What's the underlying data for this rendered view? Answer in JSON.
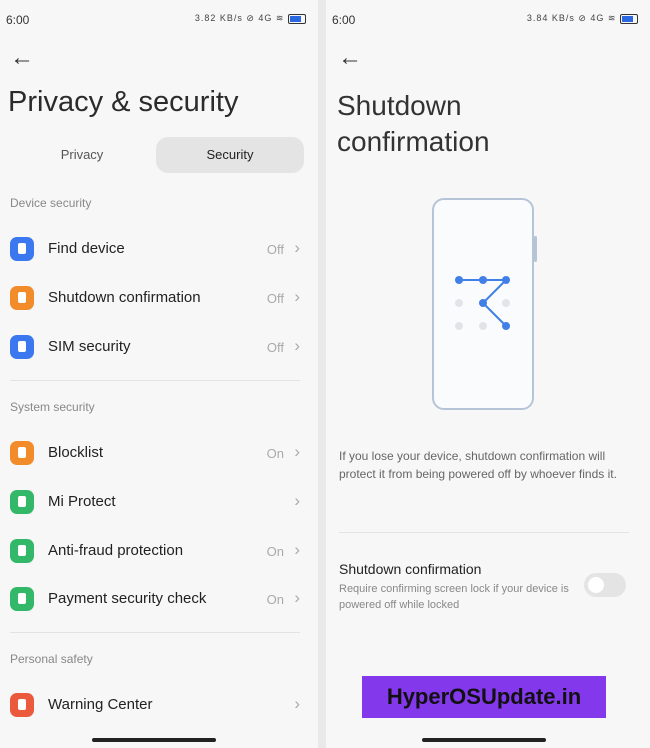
{
  "left": {
    "status": {
      "time": "6:00",
      "icons": "3.82 KB/s ⊘ 4G ≋"
    },
    "title": "Privacy & security",
    "tabs": [
      {
        "label": "Privacy",
        "selected": false
      },
      {
        "label": "Security",
        "selected": true
      }
    ],
    "sections": [
      {
        "label": "Device security",
        "items": [
          {
            "label": "Find device",
            "value": "Off",
            "icon": "find-device-icon",
            "color": "#3b78f0"
          },
          {
            "label": "Shutdown confirmation",
            "value": "Off",
            "icon": "lock-icon",
            "color": "#f28c2a"
          },
          {
            "label": "SIM security",
            "value": "Off",
            "icon": "sim-card-icon",
            "color": "#3b78f0"
          }
        ]
      },
      {
        "label": "System security",
        "items": [
          {
            "label": "Blocklist",
            "value": "On",
            "icon": "shield-icon",
            "color": "#f28c2a"
          },
          {
            "label": "Mi Protect",
            "value": "",
            "icon": "shield-check-icon",
            "color": "#33b86a"
          },
          {
            "label": "Anti-fraud protection",
            "value": "On",
            "icon": "phone-icon",
            "color": "#33b86a"
          },
          {
            "label": "Payment security check",
            "value": "On",
            "icon": "check-circle-icon",
            "color": "#33b86a"
          }
        ]
      },
      {
        "label": "Personal safety",
        "items": [
          {
            "label": "Warning Center",
            "value": "",
            "icon": "alarm-icon",
            "color": "#ec5a3e"
          }
        ]
      }
    ]
  },
  "right": {
    "status": {
      "time": "6:00",
      "icons": "3.84 KB/s ⊘ 4G ≋"
    },
    "title_line1": "Shutdown",
    "title_line2": "confirmation",
    "description": "If you lose your device, shutdown confirmation will protect it from being powered off by whoever finds it.",
    "setting": {
      "title": "Shutdown confirmation",
      "subtitle": "Require confirming screen lock if your device is powered off while locked",
      "enabled": false
    },
    "watermark": "HyperOSUpdate.in"
  }
}
